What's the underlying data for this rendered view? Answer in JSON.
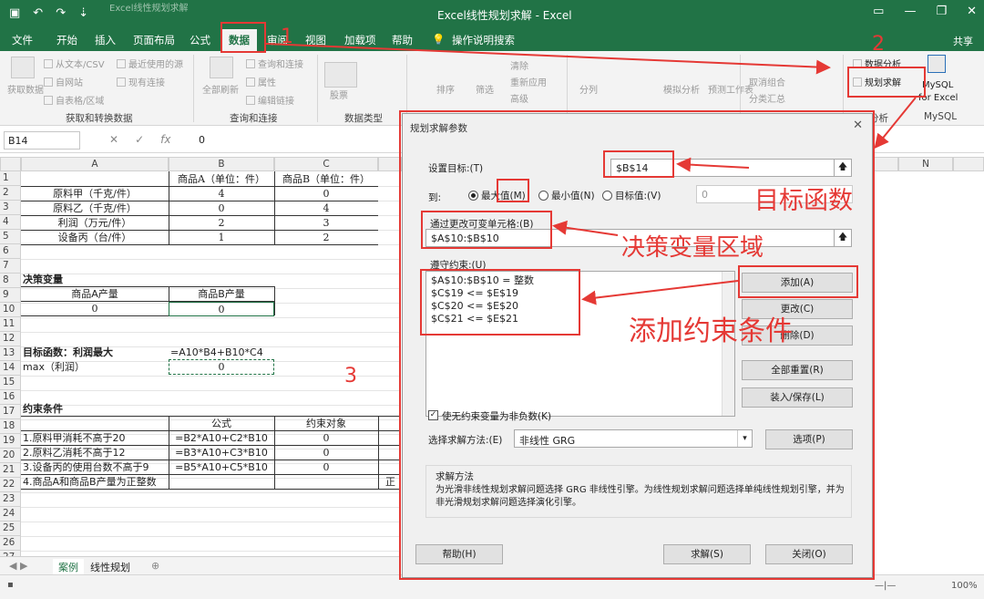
{
  "titlebar": {
    "title": "Excel线性规划求解 - Excel",
    "ghost_text": "Excel线性规划求解",
    "icons": [
      "save-icon",
      "undo-icon",
      "redo-icon",
      "customize-icon"
    ],
    "share": "共享"
  },
  "tabs": [
    "文件",
    "开始",
    "插入",
    "页面布局",
    "公式",
    "数据",
    "审阅",
    "视图",
    "加载项",
    "帮助"
  ],
  "active_tab": "数据",
  "tell_me": "操作说明搜索",
  "ribbon": {
    "get_transform": {
      "label": "获取和转换数据",
      "big": "获取数据",
      "items": [
        "从文本/CSV",
        "自网站",
        "自表格/区域",
        "最近使用的源",
        "现有连接"
      ]
    },
    "queries": {
      "label": "查询和连接",
      "big": "全部刷新",
      "items": [
        "查询和连接",
        "属性",
        "编辑链接"
      ]
    },
    "datatypes": {
      "label": "数据类型",
      "big": "股票"
    },
    "sort": {
      "items": [
        "排序",
        "筛选",
        "清除",
        "重新应用",
        "高级"
      ]
    },
    "tools": {
      "items": [
        "分列",
        "模拟分析",
        "预测工作表"
      ]
    },
    "outline": {
      "items": [
        "取消组合",
        "分类汇总"
      ]
    },
    "analysis": {
      "label": "分析",
      "items": [
        "数据分析",
        "规划求解"
      ]
    },
    "mysql": {
      "line1": "MySQL",
      "line2": "for Excel",
      "label": "MySQL"
    }
  },
  "formula_bar": {
    "name_box": "B14",
    "value": "0"
  },
  "columns": [
    "A",
    "B",
    "C",
    "N"
  ],
  "rows": [
    "1",
    "2",
    "3",
    "4",
    "5",
    "6",
    "7",
    "8",
    "9",
    "10",
    "11",
    "12",
    "13",
    "14",
    "15",
    "16",
    "17",
    "18",
    "19",
    "20",
    "21",
    "22",
    "23",
    "24",
    "25",
    "26",
    "27"
  ],
  "sheet": {
    "r1": {
      "b": "商品A（单位：件）",
      "c": "商品B（单位：件）"
    },
    "r2": {
      "a": "原料甲（千克/件）",
      "b": "4",
      "c": "0"
    },
    "r3": {
      "a": "原料乙（千克/件）",
      "b": "0",
      "c": "4"
    },
    "r4": {
      "a": "利润（万元/件）",
      "b": "2",
      "c": "3"
    },
    "r5": {
      "a": "设备丙（台/件）",
      "b": "1",
      "c": "2"
    },
    "r8": {
      "a": "决策变量"
    },
    "r9": {
      "a": "商品A产量",
      "b": "商品B产量"
    },
    "r10": {
      "a": "0",
      "b": "0"
    },
    "r13": {
      "a": "目标函数：利润最大",
      "b": "=A10*B4+B10*C4"
    },
    "r14": {
      "a": "max（利润）",
      "b": "0"
    },
    "r17": {
      "a": "约束条件"
    },
    "r18": {
      "b": "公式",
      "c": "约束对象"
    },
    "r19": {
      "a": "1.原料甲消耗不高于20",
      "b": "=B2*A10+C2*B10",
      "c": "0"
    },
    "r20": {
      "a": "2.原料乙消耗不高于12",
      "b": "=B3*A10+C3*B10",
      "c": "0"
    },
    "r21": {
      "a": "3.设备丙的使用台数不高于9",
      "b": "=B5*A10+C5*B10",
      "c": "0"
    },
    "r22": {
      "a": "4.商品A和商品B产量为正整数",
      "d": "正"
    }
  },
  "sheet_tabs": [
    "案例",
    "线性规划"
  ],
  "status": {
    "zoom": "100%"
  },
  "dialog": {
    "title": "规划求解参数",
    "set_objective_label": "设置目标:(T)",
    "objective": "$B$14",
    "to_label": "到:",
    "radios": [
      "最大值(M)",
      "最小值(N)",
      "目标值:(V)"
    ],
    "selected_radio": 0,
    "value_of": "0",
    "changing_label": "通过更改可变单元格:(B)",
    "changing": "$A$10:$B$10",
    "constraints_label": "遵守约束:(U)",
    "constraints": [
      "$A$10:$B$10 = 整数",
      "$C$19 <= $E$19",
      "$C$20 <= $E$20",
      "$C$21 <= $E$21"
    ],
    "buttons": {
      "add": "添加(A)",
      "change": "更改(C)",
      "delete": "删除(D)",
      "reset": "全部重置(R)",
      "load_save": "装入/保存(L)"
    },
    "nonneg_label": "使无约束变量为非负数(K)",
    "method_label": "选择求解方法:(E)",
    "method": "非线性 GRG",
    "options": "选项(P)",
    "method_title": "求解方法",
    "method_desc": "为光滑非线性规划求解问题选择 GRG 非线性引擎。为线性规划求解问题选择单纯线性规划引擎，并为非光滑规划求解问题选择演化引擎。",
    "help": "帮助(H)",
    "solve": "求解(S)",
    "close": "关闭(O)"
  },
  "annotations": {
    "n1": "1",
    "n2": "2",
    "n3": "3",
    "objective": "目标函数",
    "variables": "决策变量区域",
    "add_constraint": "添加约束条件"
  },
  "colors": {
    "excel_green": "#217346",
    "annotation_red": "#e53935"
  }
}
